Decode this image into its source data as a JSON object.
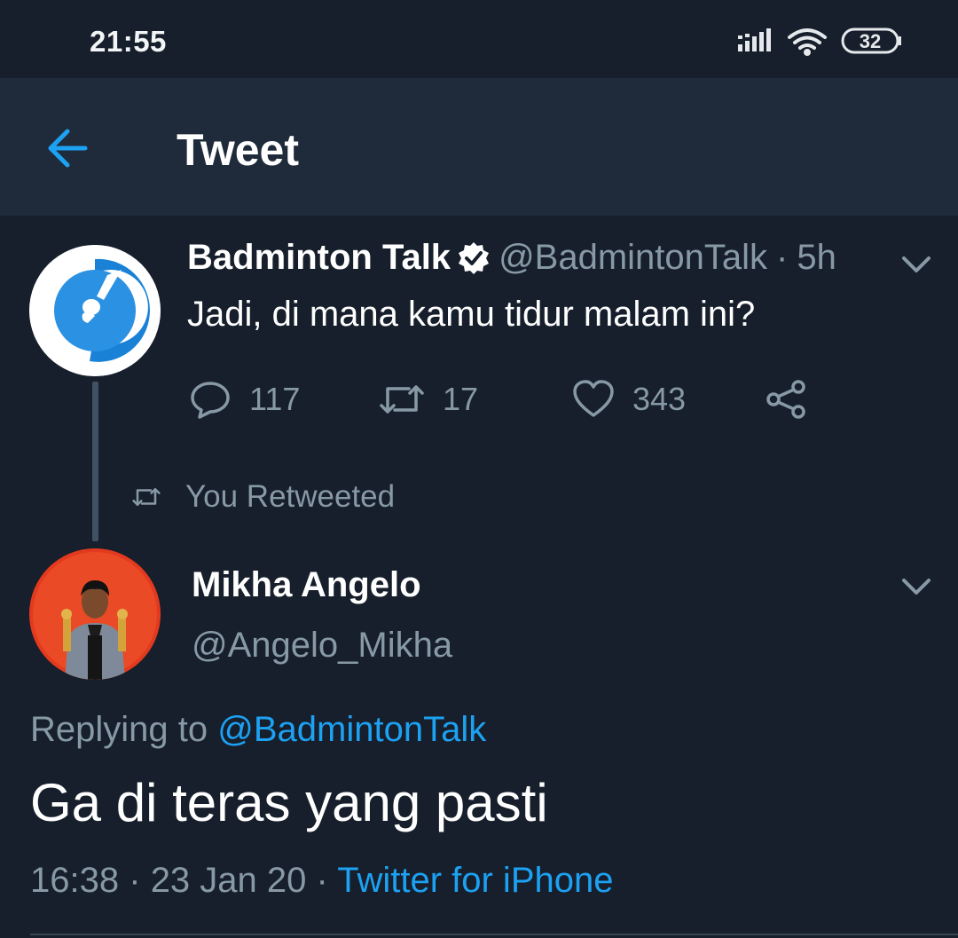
{
  "status_bar": {
    "time": "21:55",
    "battery": "32",
    "icons": [
      "signal-icon",
      "wifi-icon",
      "battery-icon"
    ]
  },
  "app_bar": {
    "title": "Tweet",
    "back_icon": "arrow-left-icon"
  },
  "colors": {
    "background": "#161f2b",
    "app_bar": "#1f2b3a",
    "accent": "#1da1f2",
    "secondary_text": "#8899a6"
  },
  "parent_tweet": {
    "author_name": "Badminton Talk",
    "verified": true,
    "handle": "@BadmintonTalk",
    "separator": "·",
    "time_ago": "5h",
    "text": "Jadi, di mana kamu tidur malam ini?",
    "actions": {
      "replies": "117",
      "retweets": "17",
      "likes": "343"
    }
  },
  "retweet_indicator": {
    "text": "You Retweeted"
  },
  "main_tweet": {
    "author_name": "Mikha Angelo",
    "handle": "@Angelo_Mikha",
    "replying_prefix": "Replying to",
    "replying_to": "@BadmintonTalk",
    "text": "Ga di teras yang pasti",
    "time": "16:38",
    "separator": "·",
    "date": "23 Jan 20",
    "source": "Twitter for iPhone"
  }
}
